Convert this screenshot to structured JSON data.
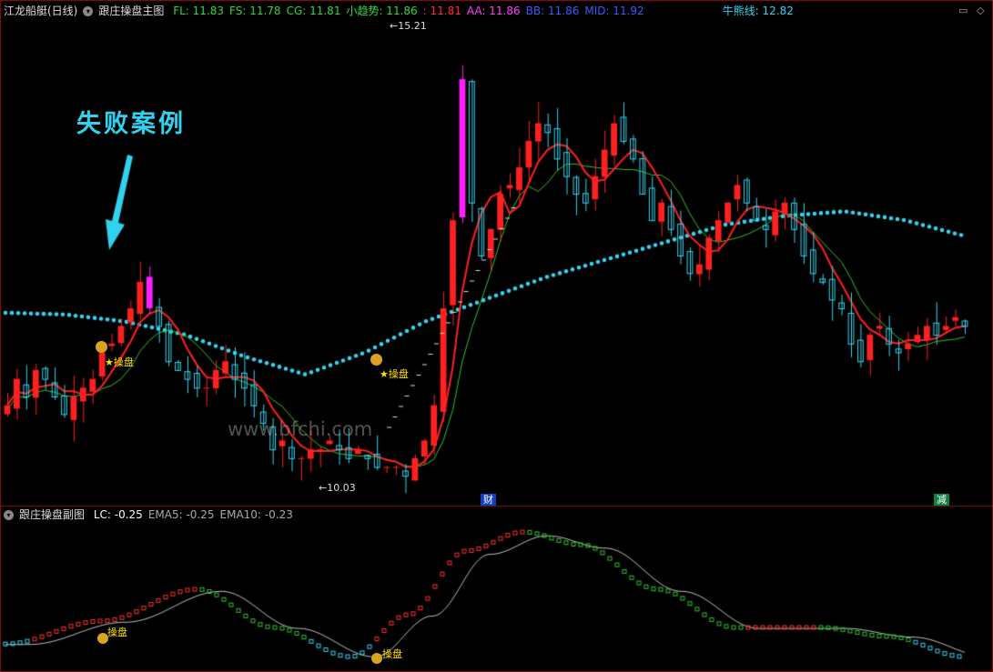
{
  "main_header": {
    "stock_name": "江龙船艇(日线)",
    "indicator_name": "跟庄操盘主图",
    "values": [
      {
        "label": "FL: 11.83",
        "color": "#31d93a"
      },
      {
        "label": "FS: 11.78",
        "color": "#31d93a"
      },
      {
        "label": "CG: 11.81",
        "color": "#31d93a"
      },
      {
        "label": "小趋势: 11.86",
        "color": "#31d93a"
      },
      {
        "label": ": 11.81",
        "color": "#ff3030"
      },
      {
        "label": "AA: 11.86",
        "color": "#ff40ff"
      },
      {
        "label": "BB: 11.86",
        "color": "#3a5cff"
      },
      {
        "label": "MID: 11.92",
        "color": "#3a5cff"
      },
      {
        "label": "牛熊线: 12.82",
        "color": "#33d4f0"
      }
    ]
  },
  "sub_header": {
    "indicator_name": "跟庄操盘副图",
    "values": [
      {
        "label": "LC: -0.25",
        "color": "#ffffff"
      },
      {
        "label": "EMA5: -0.25",
        "color": "#aaaaaa"
      },
      {
        "label": "EMA10: -0.23",
        "color": "#aaaaaa"
      }
    ]
  },
  "annotations": {
    "title": "失败案例",
    "watermark": "www.bfchi.com",
    "high_price": "15.21",
    "low_price": "10.03",
    "signal_label": "操盘",
    "event_cai": "财",
    "event_jian": "减"
  },
  "colors": {
    "up": "#ff2020",
    "down": "#33d4f0",
    "magenta": "#ff20ff",
    "trend": "#ff2020",
    "green_line": "#30c030",
    "dots": "#33d4f0"
  },
  "chart_data": {
    "type": "candlestick",
    "price_range": [
      10.03,
      15.21
    ],
    "candles_close": [
      10.9,
      11.2,
      11.0,
      11.3,
      11.2,
      11.0,
      10.8,
      11.0,
      11.1,
      11.2,
      11.5,
      11.6,
      11.8,
      12.0,
      12.3,
      12.0,
      11.8,
      11.4,
      11.3,
      11.2,
      11.1,
      11.1,
      11.3,
      11.4,
      11.2,
      11.1,
      10.9,
      10.7,
      10.4,
      10.5,
      10.3,
      10.3,
      10.4,
      10.4,
      10.5,
      10.4,
      10.3,
      10.4,
      10.3,
      10.2,
      10.2,
      10.2,
      10.1,
      10.3,
      10.5,
      10.9,
      12.0,
      13.0,
      14.6,
      13.2,
      12.6,
      12.9,
      13.3,
      13.4,
      13.6,
      13.9,
      14.1,
      14.0,
      13.7,
      13.5,
      13.3,
      13.2,
      13.5,
      13.8,
      14.1,
      13.9,
      13.7,
      13.3,
      13.0,
      13.2,
      12.9,
      12.6,
      12.4,
      12.5,
      12.8,
      13.0,
      13.2,
      13.4,
      13.2,
      13.0,
      12.9,
      13.1,
      13.2,
      12.9,
      12.6,
      12.4,
      12.3,
      12.1,
      12.0,
      11.6,
      11.4,
      11.7,
      11.8,
      11.6,
      11.5,
      11.6,
      11.7,
      11.8,
      11.7,
      11.8,
      11.9,
      11.8
    ],
    "bull_bear_line": [
      11.95,
      11.93,
      11.85,
      11.7,
      11.45,
      11.25,
      11.5,
      11.85,
      12.1,
      12.35,
      12.55,
      12.75,
      12.95,
      13.05,
      13.1,
      13.0,
      12.82
    ],
    "signals": [
      "操盘",
      "操盘"
    ]
  }
}
